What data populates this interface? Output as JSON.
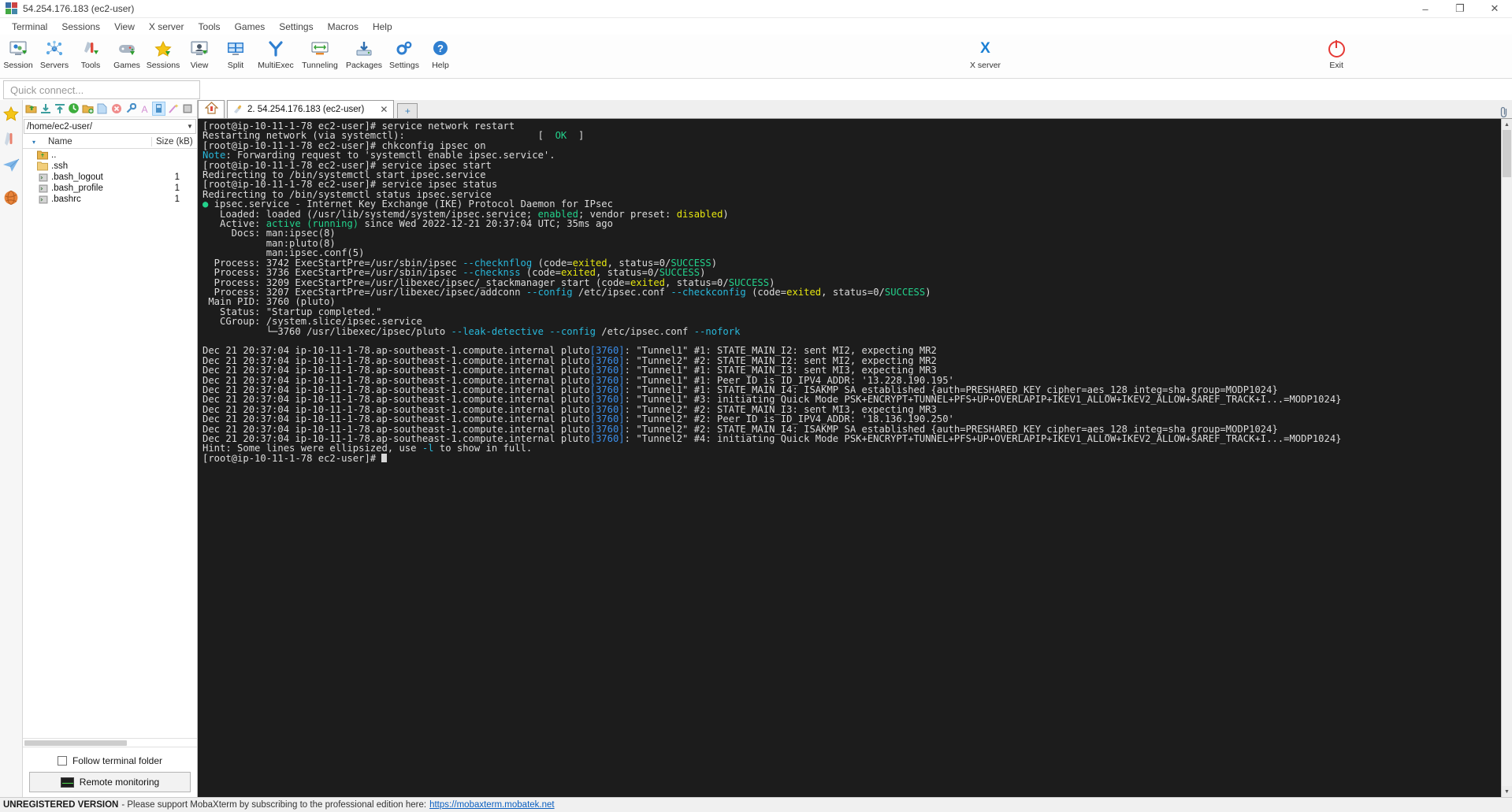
{
  "window": {
    "title": "54.254.176.183 (ec2-user)",
    "icon": "mobaxterm-logo-icon",
    "controls": {
      "minimize": "–",
      "maximize": "❐",
      "close": "✕"
    }
  },
  "menubar": {
    "items": [
      "Terminal",
      "Sessions",
      "View",
      "X server",
      "Tools",
      "Games",
      "Settings",
      "Macros",
      "Help"
    ]
  },
  "toolbar": {
    "items": [
      {
        "label": "Session",
        "icon": "session-icon"
      },
      {
        "label": "Servers",
        "icon": "servers-icon"
      },
      {
        "label": "Tools",
        "icon": "tools-icon"
      },
      {
        "label": "Games",
        "icon": "games-icon"
      },
      {
        "label": "Sessions",
        "icon": "sessions-star-icon"
      },
      {
        "label": "View",
        "icon": "view-icon"
      },
      {
        "label": "Split",
        "icon": "split-icon"
      },
      {
        "label": "MultiExec",
        "icon": "multiexec-icon"
      },
      {
        "label": "Tunneling",
        "icon": "tunneling-icon"
      },
      {
        "label": "Packages",
        "icon": "packages-icon"
      },
      {
        "label": "Settings",
        "icon": "settings-gear-icon"
      },
      {
        "label": "Help",
        "icon": "help-icon"
      }
    ],
    "right_items": [
      {
        "label": "X server",
        "icon": "x-server-icon"
      },
      {
        "label": "Exit",
        "icon": "exit-power-icon"
      }
    ]
  },
  "quick_connect": {
    "placeholder": "Quick connect..."
  },
  "rail": {
    "buttons": [
      {
        "icon": "favorites-star-icon"
      },
      {
        "icon": "tools-knife-icon"
      },
      {
        "icon": "sftp-paperplane-icon"
      },
      {
        "icon": "globe-icon"
      }
    ]
  },
  "sftp": {
    "toolbar_icons": [
      "parent-folder-icon",
      "download-icon",
      "upload-icon",
      "refresh-icon",
      "new-folder-icon",
      "new-file-icon",
      "delete-icon",
      "permissions-icon",
      "text-mode-icon",
      "binary-mode-icon",
      "wand-icon",
      "terminal-icon"
    ],
    "path": "/home/ec2-user/",
    "columns": {
      "sort_arrow": "▾",
      "name": "Name",
      "size": "Size (kB)"
    },
    "files": [
      {
        "icon": "parent-folder-icon",
        "name": "..",
        "size": ""
      },
      {
        "icon": "folder-icon",
        "name": ".ssh",
        "size": ""
      },
      {
        "icon": "script-file-icon",
        "name": ".bash_logout",
        "size": "1"
      },
      {
        "icon": "script-file-icon",
        "name": ".bash_profile",
        "size": "1"
      },
      {
        "icon": "script-file-icon",
        "name": ".bashrc",
        "size": "1"
      }
    ],
    "follow_terminal_folder": {
      "label": "Follow terminal folder",
      "checked": false
    },
    "remote_monitoring": {
      "label": "Remote monitoring",
      "icon": "monitor-graph-icon"
    }
  },
  "tabs": {
    "home_icon": "home-icon",
    "open": [
      {
        "icon": "ssh-session-icon",
        "label": "2. 54.254.176.183 (ec2-user)",
        "close": "✕",
        "active": true
      }
    ],
    "new_tab": "+",
    "clip_icon": "paperclip-icon"
  },
  "terminal": {
    "prompt": "[root@ip-10-11-1-78 ec2-user]#",
    "lines": [
      [
        {
          "t": "[root@ip-10-11-1-78 ec2-user]# service network restart",
          "c": "c-def"
        }
      ],
      [
        {
          "t": "Restarting network (via systemctl):                       [  ",
          "c": "c-def"
        },
        {
          "t": "OK",
          "c": "c-grn"
        },
        {
          "t": "  ]",
          "c": "c-def"
        }
      ],
      [
        {
          "t": "[root@ip-10-11-1-78 ec2-user]# chkconfig ipsec on",
          "c": "c-def"
        }
      ],
      [
        {
          "t": "Note",
          "c": "c-cyn"
        },
        {
          "t": ": Forwarding request to 'systemctl enable ipsec.service'.",
          "c": "c-def"
        }
      ],
      [
        {
          "t": "[root@ip-10-11-1-78 ec2-user]# service ipsec start",
          "c": "c-def"
        }
      ],
      [
        {
          "t": "Redirecting to /bin/systemctl start ipsec.service",
          "c": "c-def"
        }
      ],
      [
        {
          "t": "[root@ip-10-11-1-78 ec2-user]# service ipsec status",
          "c": "c-def"
        }
      ],
      [
        {
          "t": "Redirecting to /bin/systemctl status ipsec.service",
          "c": "c-def"
        }
      ],
      [
        {
          "t": "● ",
          "c": "c-grn"
        },
        {
          "t": "ipsec.service - Internet Key Exchange (IKE) Protocol Daemon for IPsec",
          "c": "c-def"
        }
      ],
      [
        {
          "t": "   Loaded: loaded (/usr/lib/systemd/system/ipsec.service; ",
          "c": "c-def"
        },
        {
          "t": "enabled",
          "c": "c-grn"
        },
        {
          "t": "; vendor preset: ",
          "c": "c-def"
        },
        {
          "t": "disabled",
          "c": "c-ylw"
        },
        {
          "t": ")",
          "c": "c-def"
        }
      ],
      [
        {
          "t": "   Active: ",
          "c": "c-def"
        },
        {
          "t": "active (running)",
          "c": "c-grn"
        },
        {
          "t": " since Wed 2022-12-21 20:37:04 UTC; 35ms ago",
          "c": "c-def"
        }
      ],
      [
        {
          "t": "     Docs: man:ipsec(8)",
          "c": "c-def"
        }
      ],
      [
        {
          "t": "           man:pluto(8)",
          "c": "c-def"
        }
      ],
      [
        {
          "t": "           man:ipsec.conf(5)",
          "c": "c-def"
        }
      ],
      [
        {
          "t": "  Process: 3742 ExecStartPre=/usr/sbin/ipsec ",
          "c": "c-def"
        },
        {
          "t": "--checknflog",
          "c": "c-cyn"
        },
        {
          "t": " (code=",
          "c": "c-def"
        },
        {
          "t": "exited",
          "c": "c-ylw"
        },
        {
          "t": ", status=0/",
          "c": "c-def"
        },
        {
          "t": "SUCCESS",
          "c": "c-grn"
        },
        {
          "t": ")",
          "c": "c-def"
        }
      ],
      [
        {
          "t": "  Process: 3736 ExecStartPre=/usr/sbin/ipsec ",
          "c": "c-def"
        },
        {
          "t": "--checknss",
          "c": "c-cyn"
        },
        {
          "t": " (code=",
          "c": "c-def"
        },
        {
          "t": "exited",
          "c": "c-ylw"
        },
        {
          "t": ", status=0/",
          "c": "c-def"
        },
        {
          "t": "SUCCESS",
          "c": "c-grn"
        },
        {
          "t": ")",
          "c": "c-def"
        }
      ],
      [
        {
          "t": "  Process: 3209 ExecStartPre=/usr/libexec/ipsec/_stackmanager start (code=",
          "c": "c-def"
        },
        {
          "t": "exited",
          "c": "c-ylw"
        },
        {
          "t": ", status=0/",
          "c": "c-def"
        },
        {
          "t": "SUCCESS",
          "c": "c-grn"
        },
        {
          "t": ")",
          "c": "c-def"
        }
      ],
      [
        {
          "t": "  Process: 3207 ExecStartPre=/usr/libexec/ipsec/addconn ",
          "c": "c-def"
        },
        {
          "t": "--config",
          "c": "c-cyn"
        },
        {
          "t": " /etc/ipsec.conf ",
          "c": "c-def"
        },
        {
          "t": "--checkconfig",
          "c": "c-cyn"
        },
        {
          "t": " (code=",
          "c": "c-def"
        },
        {
          "t": "exited",
          "c": "c-ylw"
        },
        {
          "t": ", status=0/",
          "c": "c-def"
        },
        {
          "t": "SUCCESS",
          "c": "c-grn"
        },
        {
          "t": ")",
          "c": "c-def"
        }
      ],
      [
        {
          "t": " Main PID: 3760 (pluto)",
          "c": "c-def"
        }
      ],
      [
        {
          "t": "   Status: \"Startup completed.\"",
          "c": "c-def"
        }
      ],
      [
        {
          "t": "   CGroup: /system.slice/ipsec.service",
          "c": "c-def"
        }
      ],
      [
        {
          "t": "           └─3760 /usr/libexec/ipsec/pluto ",
          "c": "c-def"
        },
        {
          "t": "--leak-detective",
          "c": "c-cyn"
        },
        {
          "t": " ",
          "c": "c-def"
        },
        {
          "t": "--config",
          "c": "c-cyn"
        },
        {
          "t": " /etc/ipsec.conf ",
          "c": "c-def"
        },
        {
          "t": "--nofork",
          "c": "c-cyn"
        }
      ],
      [
        {
          "t": "",
          "c": "c-def"
        }
      ],
      [
        {
          "t": "Dec 21 20:37:04 ip-10-11-1-78.ap-southeast-1.compute.internal pluto",
          "c": "c-def"
        },
        {
          "t": "[3760]",
          "c": "c-blu"
        },
        {
          "t": ": \"Tunnel1\" #1: STATE_MAIN_I2: sent MI2, expecting MR2",
          "c": "c-def"
        }
      ],
      [
        {
          "t": "Dec 21 20:37:04 ip-10-11-1-78.ap-southeast-1.compute.internal pluto",
          "c": "c-def"
        },
        {
          "t": "[3760]",
          "c": "c-blu"
        },
        {
          "t": ": \"Tunnel2\" #2: STATE_MAIN_I2: sent MI2, expecting MR2",
          "c": "c-def"
        }
      ],
      [
        {
          "t": "Dec 21 20:37:04 ip-10-11-1-78.ap-southeast-1.compute.internal pluto",
          "c": "c-def"
        },
        {
          "t": "[3760]",
          "c": "c-blu"
        },
        {
          "t": ": \"Tunnel1\" #1: STATE_MAIN_I3: sent MI3, expecting MR3",
          "c": "c-def"
        }
      ],
      [
        {
          "t": "Dec 21 20:37:04 ip-10-11-1-78.ap-southeast-1.compute.internal pluto",
          "c": "c-def"
        },
        {
          "t": "[3760]",
          "c": "c-blu"
        },
        {
          "t": ": \"Tunnel1\" #1: Peer ID is ID_IPV4_ADDR: '13.228.190.195'",
          "c": "c-def"
        }
      ],
      [
        {
          "t": "Dec 21 20:37:04 ip-10-11-1-78.ap-southeast-1.compute.internal pluto",
          "c": "c-def"
        },
        {
          "t": "[3760]",
          "c": "c-blu"
        },
        {
          "t": ": \"Tunnel1\" #1: STATE_MAIN_I4: ISAKMP SA established {auth=PRESHARED_KEY cipher=aes_128 integ=sha group=MODP1024}",
          "c": "c-def"
        }
      ],
      [
        {
          "t": "Dec 21 20:37:04 ip-10-11-1-78.ap-southeast-1.compute.internal pluto",
          "c": "c-def"
        },
        {
          "t": "[3760]",
          "c": "c-blu"
        },
        {
          "t": ": \"Tunnel1\" #3: initiating Quick Mode PSK+ENCRYPT+TUNNEL+PFS+UP+OVERLAPIP+IKEV1_ALLOW+IKEV2_ALLOW+SAREF_TRACK+I...=MODP1024}",
          "c": "c-def"
        }
      ],
      [
        {
          "t": "Dec 21 20:37:04 ip-10-11-1-78.ap-southeast-1.compute.internal pluto",
          "c": "c-def"
        },
        {
          "t": "[3760]",
          "c": "c-blu"
        },
        {
          "t": ": \"Tunnel2\" #2: STATE_MAIN_I3: sent MI3, expecting MR3",
          "c": "c-def"
        }
      ],
      [
        {
          "t": "Dec 21 20:37:04 ip-10-11-1-78.ap-southeast-1.compute.internal pluto",
          "c": "c-def"
        },
        {
          "t": "[3760]",
          "c": "c-blu"
        },
        {
          "t": ": \"Tunnel2\" #2: Peer ID is ID_IPV4_ADDR: '18.136.190.250'",
          "c": "c-def"
        }
      ],
      [
        {
          "t": "Dec 21 20:37:04 ip-10-11-1-78.ap-southeast-1.compute.internal pluto",
          "c": "c-def"
        },
        {
          "t": "[3760]",
          "c": "c-blu"
        },
        {
          "t": ": \"Tunnel2\" #2: STATE_MAIN_I4: ISAKMP SA established {auth=PRESHARED_KEY cipher=aes_128 integ=sha group=MODP1024}",
          "c": "c-def"
        }
      ],
      [
        {
          "t": "Dec 21 20:37:04 ip-10-11-1-78.ap-southeast-1.compute.internal pluto",
          "c": "c-def"
        },
        {
          "t": "[3760]",
          "c": "c-blu"
        },
        {
          "t": ": \"Tunnel2\" #4: initiating Quick Mode PSK+ENCRYPT+TUNNEL+PFS+UP+OVERLAPIP+IKEV1_ALLOW+IKEV2_ALLOW+SAREF_TRACK+I...=MODP1024}",
          "c": "c-def"
        }
      ],
      [
        {
          "t": "Hint: Some lines were ellipsized, use ",
          "c": "c-def"
        },
        {
          "t": "-l",
          "c": "c-cyn"
        },
        {
          "t": " to show in full.",
          "c": "c-def"
        }
      ],
      [
        {
          "t": "[root@ip-10-11-1-78 ec2-user]# ",
          "c": "c-def"
        },
        {
          "t": "__CURSOR__",
          "c": "cursor"
        }
      ]
    ]
  },
  "statusbar": {
    "unregistered": "UNREGISTERED VERSION",
    "message": "- Please support MobaXterm by subscribing to the professional edition here:",
    "link": "https://mobaxterm.mobatek.net"
  },
  "colors": {
    "accent_blue": "#1a7fd4",
    "terminal_bg": "#1c1c1c",
    "terminal_fg": "#dcdcdc",
    "green": "#23d18b",
    "cyan": "#29b8db",
    "yellow": "#e5e510",
    "link": "#0a5fc0"
  }
}
